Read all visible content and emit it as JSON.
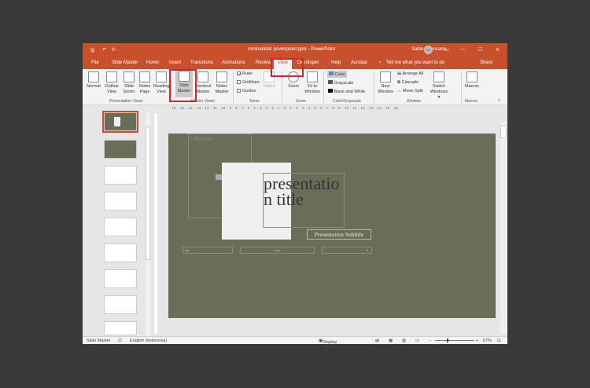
{
  "window": {
    "title": "minimalistic powerpoint.pptx - PowerPoint",
    "user": "Sabina Kencana",
    "user_initials": "SK"
  },
  "tabs": [
    "File",
    "Slide Master",
    "Home",
    "Insert",
    "Transitions",
    "Animations",
    "Review",
    "View",
    "Developer",
    "Help",
    "Acrobat"
  ],
  "tell_me": "Tell me what you want to do",
  "share": "Share",
  "ribbon": {
    "presentation_views": {
      "label": "Presentation Views",
      "buttons": [
        "Normal",
        "Outline View",
        "Slide Sorter",
        "Notes Page",
        "Reading View"
      ]
    },
    "master_views": {
      "label": "Master Views",
      "buttons": [
        "Slide Master",
        "Handout Master",
        "Notes Master"
      ]
    },
    "show": {
      "label": "Show",
      "checks": [
        {
          "label": "Ruler",
          "checked": true
        },
        {
          "label": "Gridlines",
          "checked": false
        },
        {
          "label": "Guides",
          "checked": false
        }
      ],
      "notes": "Notes"
    },
    "zoom": {
      "label": "Zoom",
      "buttons": [
        "Zoom",
        "Fit to Window"
      ]
    },
    "color": {
      "label": "Color/Grayscale",
      "items": [
        "Color",
        "Grayscale",
        "Black and White"
      ]
    },
    "window": {
      "label": "Window",
      "new": "New Window",
      "items": [
        "Arrange All",
        "Cascade",
        "Move Split"
      ],
      "switch": "Switch Windows"
    },
    "macros": {
      "label": "Macros",
      "button": "Macros"
    }
  },
  "ruler": "· 16 · 15 · 14 · 13 · 12 · 11 · 10 · 9 · 8 · 7 · 6 · 5 · 4 · 3 · 2 · 1 · 0 · 1 · 2 · 3 · 4 · 5 · 6 · 7 · 8 · 9 · 10 · 11 · 12 · 13 · 14 · 15 · 16 ·",
  "slide": {
    "picture_placeholder": "• Picture",
    "title": "presentation title",
    "subtitle": "Presentation Subtitle",
    "footer_date": "date",
    "footer": "Footer",
    "footer_number": "#",
    "bg": "#6a6e58"
  },
  "status": {
    "mode": "Slide Master",
    "language": "English (Indonesia)",
    "display": "Display Settings",
    "zoom": "67%"
  },
  "colors": {
    "accent": "#c8502c",
    "highlight": "#e0202a"
  }
}
